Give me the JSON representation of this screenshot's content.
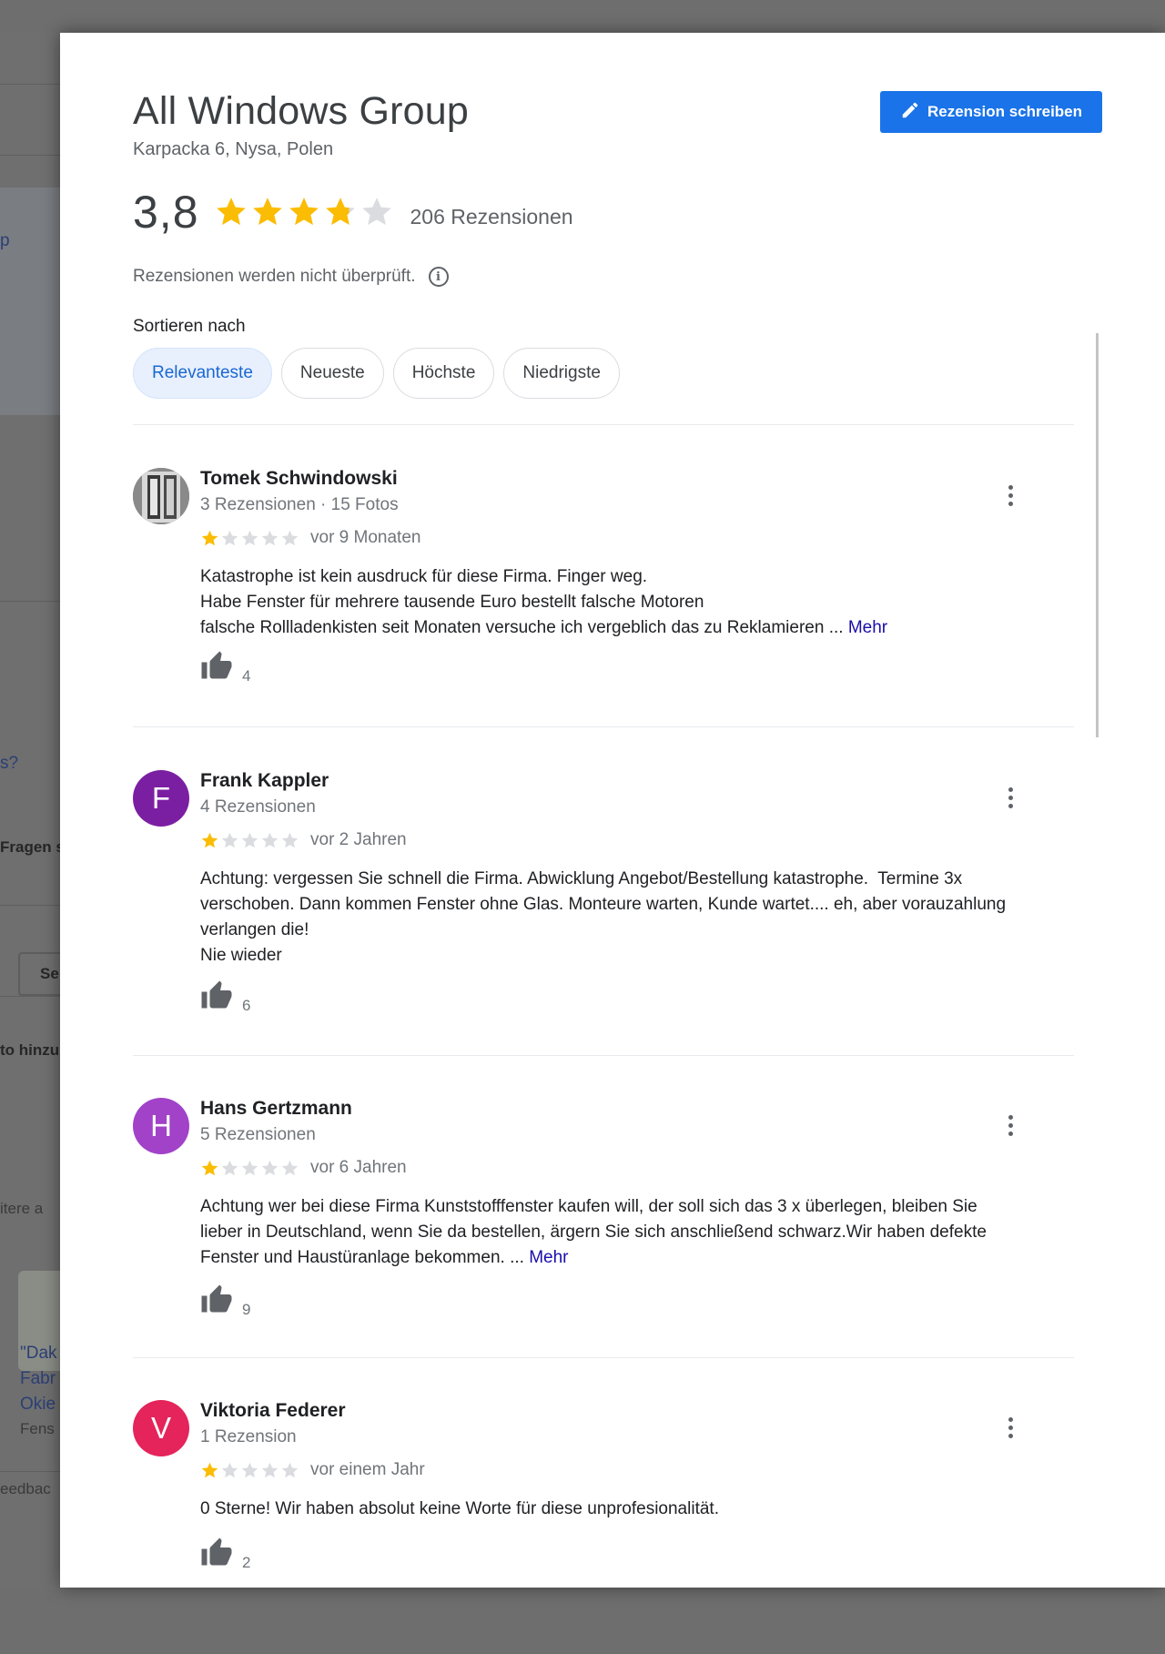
{
  "background": {
    "fragments": [
      "p",
      "s?",
      "Fragen s",
      "Se",
      "to hinzu",
      "itere a",
      "\"Dak",
      "Fabr",
      "Okie",
      "Fens",
      "eedbac"
    ]
  },
  "place": {
    "name": "All Windows Group",
    "address": "Karpacka 6, Nysa, Polen",
    "rating": "3,8",
    "rating_value": 3.8,
    "review_count_label": "206 Rezensionen",
    "notice": "Rezensionen werden nicht überprüft.",
    "info_icon": "info-icon"
  },
  "actions": {
    "write_review": "Rezension schreiben",
    "write_icon": "pencil-icon"
  },
  "sort": {
    "label": "Sortieren nach",
    "options": [
      "Relevanteste",
      "Neueste",
      "Höchste",
      "Niedrigste"
    ],
    "selected": "Relevanteste"
  },
  "colors": {
    "accent": "#1a73e8",
    "star": "#fbbc04",
    "star_empty": "#dadce0",
    "link": "#1a0dab"
  },
  "reviews": [
    {
      "name": "Tomek Schwindowski",
      "meta": "3 Rezensionen · 15 Fotos",
      "avatar_letter": "",
      "avatar_color": "#707070",
      "stars": 1,
      "date": "vor 9 Monaten",
      "lines": [
        "Katastrophe ist kein ausdruck für diese Firma. Finger weg.",
        "Habe Fenster für mehrere tausende Euro bestellt falsche Motoren",
        "falsche Rollladenkisten seit Monaten versuche ich vergeblich das zu Reklamieren ..."
      ],
      "more": "Mehr",
      "likes": "4"
    },
    {
      "name": "Frank Kappler",
      "meta": "4 Rezensionen",
      "avatar_letter": "F",
      "avatar_color": "#7b1fa2",
      "stars": 1,
      "date": "vor 2 Jahren",
      "lines": [
        "Achtung: vergessen Sie schnell die Firma. Abwicklung Angebot/Bestellung katastrophe.  Termine 3x",
        "verschoben. Dann kommen Fenster ohne Glas. Monteure warten, Kunde wartet.... eh, aber vorauzahlung",
        "verlangen die!",
        "Nie wieder"
      ],
      "more": "",
      "likes": "6"
    },
    {
      "name": "Hans Gertzmann",
      "meta": "5 Rezensionen",
      "avatar_letter": "H",
      "avatar_color": "#a142c9",
      "stars": 1,
      "date": "vor 6 Jahren",
      "lines": [
        "Achtung wer bei diese Firma Kunststofffenster kaufen will, der soll sich das 3 x überlegen, bleiben Sie",
        "lieber in Deutschland, wenn Sie da bestellen, ärgern Sie sich anschließend schwarz.Wir haben defekte",
        "Fenster und Haustüranlage bekommen. ..."
      ],
      "more": "Mehr",
      "likes": "9"
    },
    {
      "name": "Viktoria Federer",
      "meta": "1 Rezension",
      "avatar_letter": "V",
      "avatar_color": "#e4245a",
      "stars": 1,
      "date": "vor einem Jahr",
      "lines": [
        "0 Sterne! Wir haben absolut keine Worte für diese unprofesionalität."
      ],
      "more": "",
      "likes": "2"
    }
  ]
}
